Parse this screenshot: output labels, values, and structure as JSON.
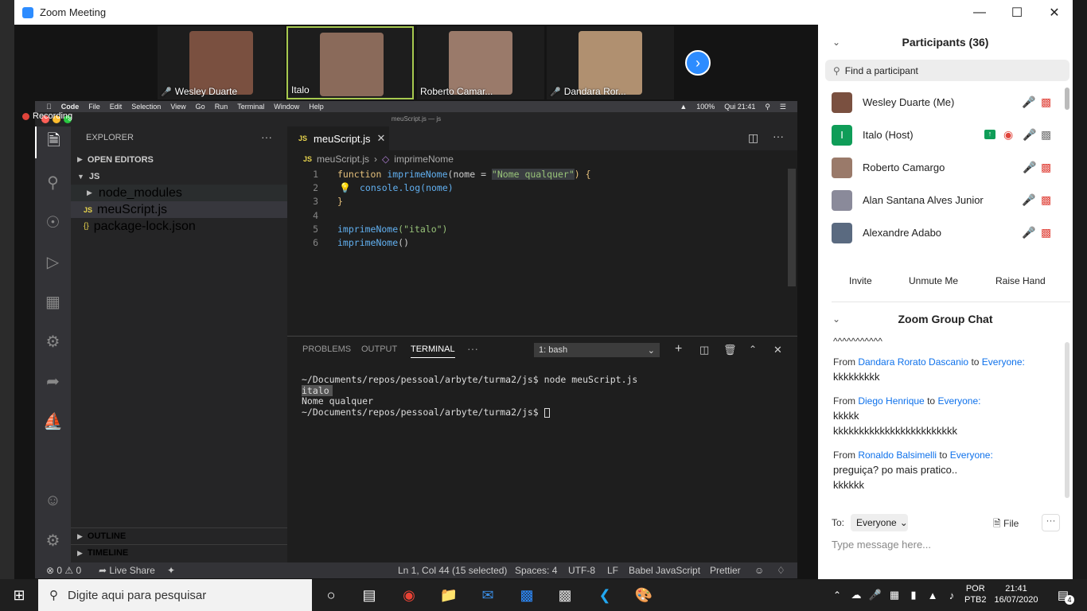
{
  "zoom": {
    "title": "Zoom Meeting",
    "recording": "Recording",
    "thumbnails": [
      {
        "name": "Wesley Duarte",
        "muted": true,
        "color": "#7a5040"
      },
      {
        "name": "Italo",
        "muted": false,
        "color": "#8a6a5a"
      },
      {
        "name": "Roberto Camar...",
        "muted": false,
        "color": "#9a7a6a"
      },
      {
        "name": "Dandara Ror...",
        "muted": true,
        "color": "#b09070"
      }
    ],
    "participants": {
      "header": "Participants (36)",
      "search_placeholder": "Find a participant",
      "list": [
        {
          "name": "Wesley Duarte (Me)"
        },
        {
          "name": "Italo (Host)",
          "avatar_letter": "I"
        },
        {
          "name": "Roberto Camargo"
        },
        {
          "name": "Alan Santana Alves Junior"
        },
        {
          "name": "Alexandre Adabo"
        }
      ],
      "buttons": {
        "invite": "Invite",
        "unmute": "Unmute Me",
        "raise": "Raise Hand"
      }
    },
    "chat": {
      "header": "Zoom Group Chat",
      "top_line": "^^^^^^^^^^^",
      "messages": [
        {
          "from": "Dandara Rorato Dascanio",
          "to": "Everyone:",
          "lines": [
            "kkkkkkkkk"
          ]
        },
        {
          "from": "Diego Henrique",
          "to": "Everyone:",
          "lines": [
            "kkkkk",
            "kkkkkkkkkkkkkkkkkkkkkkkk"
          ]
        },
        {
          "from": "Ronaldo Balsimelli",
          "to": "Everyone:",
          "lines": [
            "preguiça? po mais pratico..",
            "kkkkkk"
          ]
        }
      ],
      "from_word": "From",
      "to_word": "to",
      "to_label": "To:",
      "to_value": "Everyone",
      "file": "File",
      "input_placeholder": "Type message here..."
    }
  },
  "mac_menu": {
    "items": [
      "Code",
      "File",
      "Edit",
      "Selection",
      "View",
      "Go",
      "Run",
      "Terminal",
      "Window",
      "Help"
    ],
    "battery": "100%",
    "clock": "Qui 21:41",
    "window_title": "meuScript.js — js"
  },
  "vscode": {
    "explorer_title": "EXPLORER",
    "open_editors": "OPEN EDITORS",
    "folder": "JS",
    "files": [
      "node_modules",
      "meuScript.js",
      "package-lock.json"
    ],
    "outline": "OUTLINE",
    "timeline": "TIMELINE",
    "tab": "meuScript.js",
    "breadcrumb_file": "meuScript.js",
    "breadcrumb_symbol": "imprimeNome",
    "line_numbers": [
      "1",
      "2",
      "3",
      "4",
      "5",
      "6"
    ],
    "code": {
      "l1_kw": "function",
      "l1_fn": "imprimeNome",
      "l1_open": "(",
      "l1_param": "nome",
      "l1_eq": " = ",
      "l1_str": "\"Nome qualquer\"",
      "l1_close": ") {",
      "l2": "console.log(nome)",
      "l3": "}",
      "l5_fn": "imprimeNome",
      "l5_arg": "(\"italo\")",
      "l6_fn": "imprimeNome",
      "l6_arg": "()"
    },
    "panel_tabs": [
      "PROBLEMS",
      "OUTPUT",
      "TERMINAL"
    ],
    "terminal_select": "1: bash",
    "terminal_lines": [
      "~/Documents/repos/pessoal/arbyte/turma2/js$ node meuScript.js",
      "italo",
      "Nome qualquer",
      "~/Documents/repos/pessoal/arbyte/turma2/js$ "
    ],
    "status": {
      "errors": "0",
      "warnings": "0",
      "live_share": "Live Share",
      "position": "Ln 1, Col 44 (15 selected)",
      "spaces": "Spaces: 4",
      "encoding": "UTF-8",
      "eol": "LF",
      "language": "Babel JavaScript",
      "formatter": "Prettier"
    }
  },
  "taskbar": {
    "search_placeholder": "Digite aqui para pesquisar",
    "lang_1": "POR",
    "lang_2": "PTB2",
    "time": "21:41",
    "date": "16/07/2020",
    "notifications": "4"
  }
}
